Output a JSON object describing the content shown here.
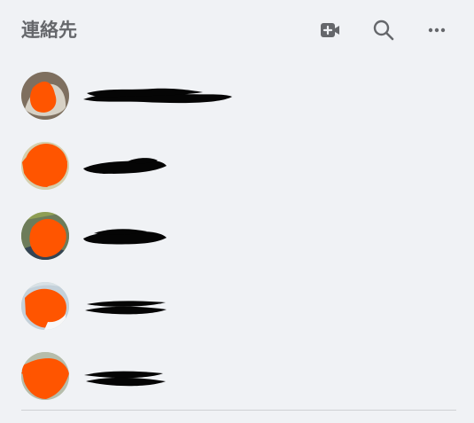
{
  "header": {
    "title": "連絡先",
    "icons": [
      "video-add-icon",
      "search-icon",
      "more-icon"
    ]
  },
  "contacts": [
    {
      "name": ""
    },
    {
      "name": ""
    },
    {
      "name": ""
    },
    {
      "name": ""
    },
    {
      "name": ""
    }
  ],
  "colors": {
    "background": "#f0f2f5",
    "title": "#65676b",
    "icon": "#65676b",
    "redaction_orange": "#ff5500",
    "redaction_black": "#050505",
    "divider": "#ced0d4"
  }
}
